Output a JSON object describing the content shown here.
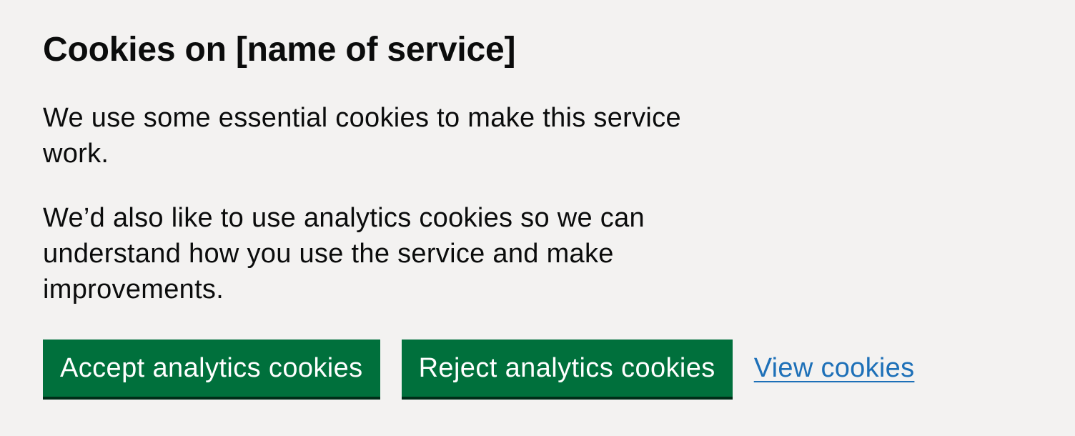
{
  "banner": {
    "heading": "Cookies on [name of service]",
    "paragraphs": [
      "We use some essential cookies to make this service work.",
      "We’d also like to use analytics cookies so we can understand how you use the service and make improvements."
    ],
    "accept_label": "Accept analytics cookies",
    "reject_label": "Reject analytics cookies",
    "view_label": "View cookies"
  },
  "colors": {
    "background": "#f3f2f1",
    "button": "#00703c",
    "button_shadow": "#002d18",
    "link": "#1d70b8",
    "text": "#0b0c0c"
  }
}
